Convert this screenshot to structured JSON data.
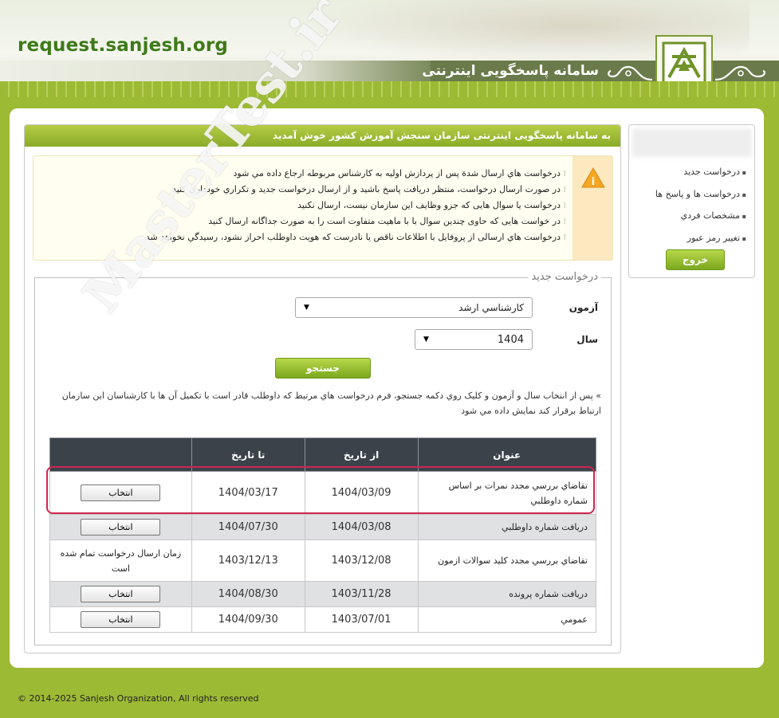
{
  "header": {
    "site_url": "request.sanjesh.org",
    "system_title": "سامانه پاسخگويی اينترنتی"
  },
  "welcome": "به سامانه پاسخگويی اينترنتی سازمان سنجش آموزش كشور خوش آمديد",
  "notices": [
    "درخواست هاي ارسال شدة پس از پردازش اوليه به کارشناس مربوطه ارجاع داده مي شود",
    "در صورت ارسال درخواست، منتظر دريافت پاسخ باشيد و از ارسال درخواست جديد و تکراري خودداري کنيد",
    "درخواست يا سوال هايی كه جزو وظايف اين سازمان نيست، ارسال نكنيد",
    "در خواست هايی كه حاوی چندين سوال با با ماهيت متفاوت است را به صورت جداگانه ارسال كنيد",
    "درخواست هاي ارسالی از پروفايل با اطلاعات ناقص يا نادرست که هويت داوطلب احراز نشود، رسيدگي نخواهد شد"
  ],
  "form": {
    "legend": "درخواست جديد",
    "exam_label": "آزمون",
    "exam_value": "كارشناسي ارشد",
    "year_label": "سال",
    "year_value": "1404",
    "search_button": "جستجو",
    "help_text": "» پس از انتخاب سال و آزمون و کليک روي دکمه جستجو، فرم درخواست هاي مرتبط كه داوطلب قادر است با تکميل آن ها با کارشناسان اين سازمان ارتباط برقرار کند نمايش داده مي شود"
  },
  "table": {
    "headers": [
      "عنوان",
      "از تاريخ",
      "تا تاريخ",
      ""
    ],
    "rows": [
      {
        "title": "تقاضاي بررسي مجدد نمرات بر اساس شماره داوطلبي",
        "from": "1404/03/09",
        "to": "1404/03/17",
        "action": "انتخاب"
      },
      {
        "title": "دريافت شماره داوطلبي",
        "from": "1404/03/08",
        "to": "1404/07/30",
        "action": "انتخاب"
      },
      {
        "title": "تقاضاي بررسي مجدد كليد سوالات ازمون",
        "from": "1403/12/08",
        "to": "1403/12/13",
        "action": "زمان ارسال درخواست تمام شده است"
      },
      {
        "title": "دريافت شماره پرونده",
        "from": "1403/11/28",
        "to": "1404/08/30",
        "action": "انتخاب"
      },
      {
        "title": "عمومي",
        "from": "1403/07/01",
        "to": "1404/09/30",
        "action": "انتخاب"
      }
    ]
  },
  "sidebar": {
    "items": [
      "درخواست جديد",
      "درخواست ها و پاسخ ها",
      "مشخصات فردي",
      "تغيير رمز عبور"
    ],
    "exit_button": "خروج"
  },
  "watermark": "MasterTest.ir",
  "footer": "© 2014-2025 Sanjesh Organization, All rights reserved",
  "colors": {
    "brand_green": "#9dba34",
    "table_header": "#3b424a",
    "highlight": "#d0264f"
  }
}
